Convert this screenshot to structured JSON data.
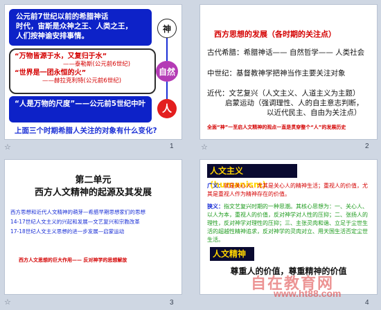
{
  "slides": [
    {
      "number": "1",
      "box1_lines": [
        "公元前7世纪以前的希腊神话",
        "时代，宙斯是众神之王、人类之王，",
        "人们按神谕安排事情。"
      ],
      "quote1": "“万物皆源于水，又复归于水”",
      "attr1": "——泰勒斯(公元前6世纪)",
      "quote2": "“世界是一团永恒的火”",
      "attr2": "——赫拉克利特(公元前6世纪)",
      "box3": "“人是万物的尺度”——公元前5世纪中叶",
      "question": "上面三个时期希腊人关注的对象有什么变化?",
      "circles": {
        "shen": "神",
        "ziran": "自然",
        "ren": "人"
      }
    },
    {
      "number": "2",
      "title": "西方思想的发展（各时期的关注点）",
      "line1": "古代希腊：希腊神话—— 自然哲学—— 人类社会",
      "line2": "中世纪：基督教神学把神当作主要关注对象",
      "line3": "近代：文艺复兴（人文主义、人道主义为主题）",
      "line4": "启蒙运动（强调理性、人的自主意志判断，",
      "line5": "以近代民主、自由为关注点）",
      "footnote": "全面“神”一至启人文精神的观点一直是贯穿整个“人”的发展历史"
    },
    {
      "number": "3",
      "title1": "第二单元",
      "title2": "西方人文精神的起源及其发展",
      "items": [
        "西方思想和近代人文精神的萌芽—希腊早期思想家们的思想",
        "14-17世纪人文主义的兴起和发展—文艺复兴和宗教改革",
        "17-18世纪人文主义思想的进一步发展—启蒙运动"
      ],
      "footnote": "西方人文思想的巨大作用—— 反对神学的思想解放"
    },
    {
      "number": "4",
      "heading": "人文主义(humanism)",
      "broad_label": "广义：",
      "broad_text": "就是关心人、尤其是关心人的精神生活；重视人的价值，尤其是重视人作为精神存在的价值。",
      "narrow_label": "狭义：",
      "narrow_text": "指文艺复兴时期的一种思潮。其核心思想为：一、关心人、以人为本，重视人的价值，反对神学对人性的压抑；二、张扬人的理性，反对神学对理性的压抑；三、主张灵肉和谐、立足于尘世生活的超越性精神追求，反对神学的灵肉对立、用天国生活否定尘世生活。",
      "heading2": "人文精神",
      "slogan": "尊重人的价值，尊重精神的价值"
    }
  ],
  "watermark": {
    "text1": "自在教育网",
    "text2": "www.ht88.com"
  },
  "star_glyph": "☆"
}
